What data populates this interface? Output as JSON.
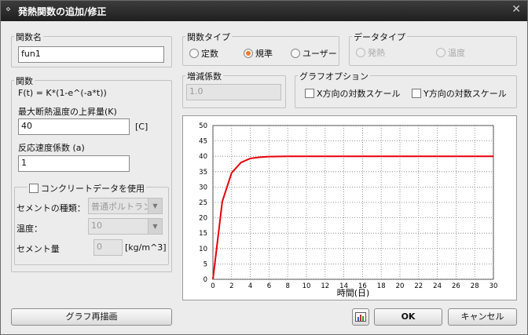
{
  "window": {
    "title": "発熱関数の追加/修正",
    "menu_glyph": "⋄",
    "close_glyph": "✕"
  },
  "func_name": {
    "label": "関数名",
    "value": "fun1"
  },
  "func_type": {
    "label": "関数タイプ",
    "options": [
      "定数",
      "規準",
      "ユーザー"
    ],
    "selected": "規準"
  },
  "data_type": {
    "label": "データタイプ",
    "options": [
      "発熱",
      "温度"
    ],
    "selected": "発熱",
    "enabled": false
  },
  "func": {
    "label": "関数",
    "formula": "F(t) = K*(1-e^(-a*t))",
    "max_temp_label": "最大断熱温度の上昇量(K)",
    "max_temp_value": "40",
    "max_temp_unit": "[C]",
    "rate_label": "反応速度係数 (a)",
    "rate_value": "1"
  },
  "concrete": {
    "checkbox_label": "コンクリートデータを使用",
    "checked": false,
    "cement_type_label": "セメントの種類：",
    "cement_type_value": "普通ポルトランド",
    "temp_label": "温度：",
    "temp_value": "10",
    "cement_amount_label": "セメント量",
    "cement_amount_value": "0",
    "cement_amount_unit": "[kg/m^3]"
  },
  "increment": {
    "label": "増減係数",
    "value": "1.0"
  },
  "graph_options": {
    "label": "グラフオプション",
    "x_log_label": "X方向の対数スケール",
    "y_log_label": "Y方向の対数スケール",
    "x_log": false,
    "y_log": false
  },
  "buttons": {
    "redraw": "グラフ再描画",
    "ok": "OK",
    "cancel": "キャンセル",
    "chart_icon": "chart-icon"
  },
  "colors": {
    "series": "#e8000b",
    "grid": "#777777"
  },
  "chart_data": {
    "type": "line",
    "xlabel": "時間(日)",
    "ylabel": "",
    "xlim": [
      0,
      30
    ],
    "ylim": [
      0,
      50
    ],
    "xticks": [
      0,
      2,
      4,
      6,
      8,
      10,
      12,
      14,
      16,
      18,
      20,
      22,
      24,
      26,
      28,
      30
    ],
    "yticks": [
      0,
      5,
      10,
      15,
      20,
      25,
      30,
      35,
      40,
      45,
      50
    ],
    "grid": true,
    "series": [
      {
        "x": [
          0,
          1,
          2,
          3,
          4,
          5,
          6,
          8,
          30
        ],
        "values": [
          0,
          25.3,
          34.6,
          38.0,
          39.3,
          39.7,
          39.9,
          40.0,
          40.0
        ]
      }
    ]
  }
}
